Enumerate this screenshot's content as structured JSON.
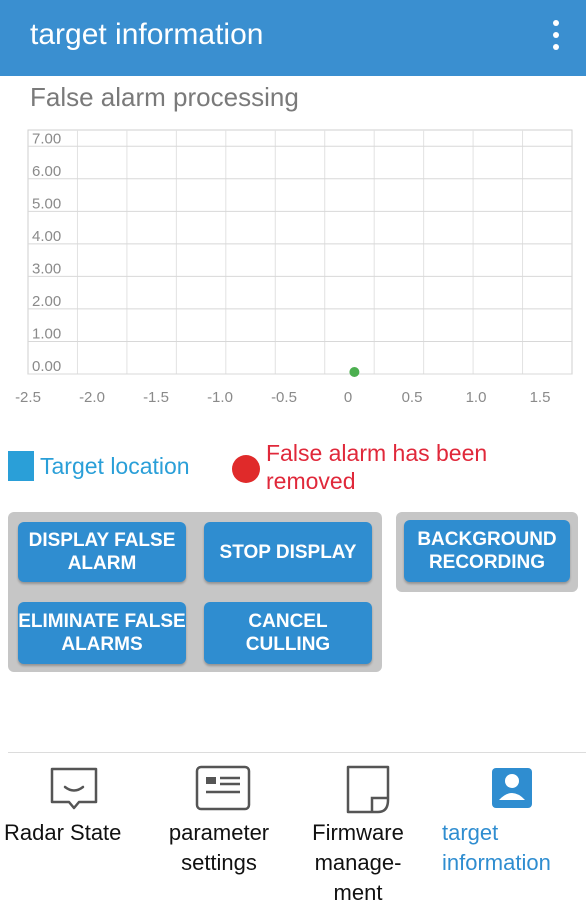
{
  "appbar": {
    "title": "target information",
    "menu_icon": "more-vert-icon"
  },
  "section": {
    "title": "False alarm processing"
  },
  "chart_data": {
    "type": "scatter",
    "xlim": [
      -2.5,
      1.75
    ],
    "ylim": [
      0,
      7.5
    ],
    "x_ticks": [
      "-2.5",
      "-2.0",
      "-1.5",
      "-1.0",
      "-0.5",
      "0",
      "0.5",
      "1.0",
      "1.5"
    ],
    "y_ticks": [
      "0.00",
      "1.00",
      "2.00",
      "3.00",
      "4.00",
      "5.00",
      "6.00",
      "7.00"
    ],
    "grid": true,
    "points": [
      {
        "x": 0.05,
        "y": 0.0,
        "color": "#4caf50"
      }
    ]
  },
  "legend": {
    "target_location": "Target location",
    "false_alarm_removed": "False alarm has been removed",
    "target_color": "#2a9fd8",
    "removed_color": "#e02a2a"
  },
  "buttons": {
    "display_false_alarm": "DISPLAY FALSE ALARM",
    "stop_display": "STOP DISPLAY",
    "eliminate_false_alarms": "ELIMINATE FALSE ALARMS",
    "cancel_culling": "CANCEL CULLING",
    "background_recording": "BACKGROUND RECORDING"
  },
  "nav": {
    "radar_state": {
      "label": "Radar State",
      "icon": "radar-state-icon"
    },
    "parameter_settings": {
      "label": "parameter settings",
      "icon": "parameter-settings-icon"
    },
    "firmware_management": {
      "label": "Firmware manage-ment",
      "icon": "firmware-management-icon"
    },
    "target_information": {
      "label": "target information",
      "icon": "target-information-icon",
      "active": true
    }
  },
  "colors": {
    "accent": "#3a8fd0",
    "button": "#2f8dd0",
    "panel": "#c6c6c6"
  }
}
